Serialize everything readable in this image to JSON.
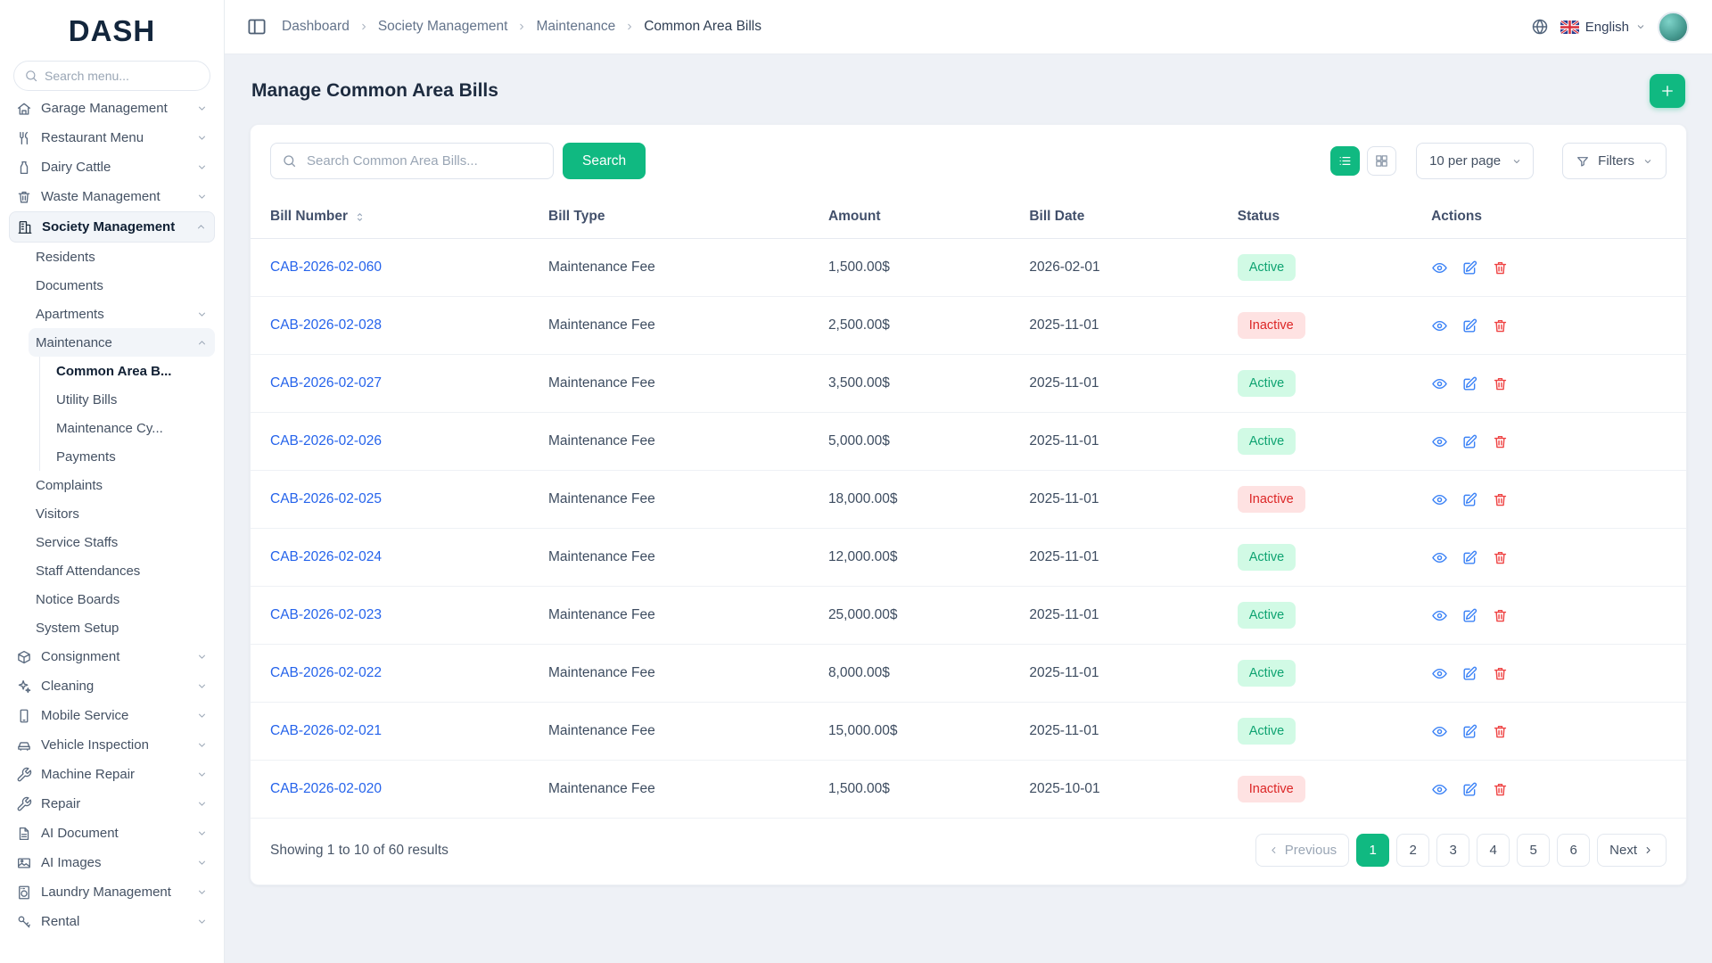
{
  "app": {
    "logo": "DASH"
  },
  "sidebar": {
    "search_placeholder": "Search menu...",
    "menu": [
      {
        "label": "Garage Management",
        "icon": "garage-icon",
        "chevron": "down"
      },
      {
        "label": "Restaurant Menu",
        "icon": "restaurant-icon",
        "chevron": "down"
      },
      {
        "label": "Dairy Cattle",
        "icon": "dairy-icon",
        "chevron": "down"
      },
      {
        "label": "Waste Management",
        "icon": "waste-icon",
        "chevron": "down"
      },
      {
        "label": "Society Management",
        "icon": "society-icon",
        "chevron": "up",
        "active": true,
        "children": [
          {
            "label": "Residents"
          },
          {
            "label": "Documents"
          },
          {
            "label": "Apartments",
            "chevron": "down"
          },
          {
            "label": "Maintenance",
            "chevron": "up",
            "open": true,
            "children": [
              {
                "label": "Common Area B...",
                "active": true
              },
              {
                "label": "Utility Bills"
              },
              {
                "label": "Maintenance Cy..."
              },
              {
                "label": "Payments"
              }
            ]
          },
          {
            "label": "Complaints"
          },
          {
            "label": "Visitors"
          },
          {
            "label": "Service Staffs"
          },
          {
            "label": "Staff Attendances"
          },
          {
            "label": "Notice Boards"
          },
          {
            "label": "System Setup"
          }
        ]
      },
      {
        "label": "Consignment",
        "icon": "consignment-icon",
        "chevron": "down"
      },
      {
        "label": "Cleaning",
        "icon": "cleaning-icon",
        "chevron": "down"
      },
      {
        "label": "Mobile Service",
        "icon": "mobile-icon",
        "chevron": "down"
      },
      {
        "label": "Vehicle Inspection",
        "icon": "vehicle-icon",
        "chevron": "down"
      },
      {
        "label": "Machine Repair",
        "icon": "machine-repair-icon",
        "chevron": "down"
      },
      {
        "label": "Repair",
        "icon": "repair-icon",
        "chevron": "down"
      },
      {
        "label": "AI Document",
        "icon": "ai-document-icon",
        "chevron": "down"
      },
      {
        "label": "AI Images",
        "icon": "ai-images-icon",
        "chevron": "down"
      },
      {
        "label": "Laundry Management",
        "icon": "laundry-icon",
        "chevron": "down"
      },
      {
        "label": "Rental",
        "icon": "rental-icon",
        "chevron": "down"
      }
    ]
  },
  "topbar": {
    "breadcrumb": [
      "Dashboard",
      "Society Management",
      "Maintenance",
      "Common Area Bills"
    ],
    "language": "English"
  },
  "page": {
    "title": "Manage Common Area Bills"
  },
  "toolbar": {
    "search_placeholder": "Search Common Area Bills...",
    "search_button": "Search",
    "per_page": "10 per page",
    "filters_label": "Filters"
  },
  "table": {
    "columns": [
      "Bill Number",
      "Bill Type",
      "Amount",
      "Bill Date",
      "Status",
      "Actions"
    ],
    "rows": [
      {
        "bill_number": "CAB-2026-02-060",
        "bill_type": "Maintenance Fee",
        "amount": "1,500.00$",
        "bill_date": "2026-02-01",
        "status": "Active"
      },
      {
        "bill_number": "CAB-2026-02-028",
        "bill_type": "Maintenance Fee",
        "amount": "2,500.00$",
        "bill_date": "2025-11-01",
        "status": "Inactive"
      },
      {
        "bill_number": "CAB-2026-02-027",
        "bill_type": "Maintenance Fee",
        "amount": "3,500.00$",
        "bill_date": "2025-11-01",
        "status": "Active"
      },
      {
        "bill_number": "CAB-2026-02-026",
        "bill_type": "Maintenance Fee",
        "amount": "5,000.00$",
        "bill_date": "2025-11-01",
        "status": "Active"
      },
      {
        "bill_number": "CAB-2026-02-025",
        "bill_type": "Maintenance Fee",
        "amount": "18,000.00$",
        "bill_date": "2025-11-01",
        "status": "Inactive"
      },
      {
        "bill_number": "CAB-2026-02-024",
        "bill_type": "Maintenance Fee",
        "amount": "12,000.00$",
        "bill_date": "2025-11-01",
        "status": "Active"
      },
      {
        "bill_number": "CAB-2026-02-023",
        "bill_type": "Maintenance Fee",
        "amount": "25,000.00$",
        "bill_date": "2025-11-01",
        "status": "Active"
      },
      {
        "bill_number": "CAB-2026-02-022",
        "bill_type": "Maintenance Fee",
        "amount": "8,000.00$",
        "bill_date": "2025-11-01",
        "status": "Active"
      },
      {
        "bill_number": "CAB-2026-02-021",
        "bill_type": "Maintenance Fee",
        "amount": "15,000.00$",
        "bill_date": "2025-11-01",
        "status": "Active"
      },
      {
        "bill_number": "CAB-2026-02-020",
        "bill_type": "Maintenance Fee",
        "amount": "1,500.00$",
        "bill_date": "2025-10-01",
        "status": "Inactive"
      }
    ]
  },
  "footer": {
    "results_text": "Showing 1 to 10 of 60 results",
    "previous": "Previous",
    "next": "Next",
    "pages": [
      "1",
      "2",
      "3",
      "4",
      "5",
      "6"
    ],
    "active_page": "1"
  },
  "icons": {
    "sidebar_toggle": "panel-icon",
    "language_globe": "globe-icon",
    "language_flag": "uk-flag-icon",
    "add": "plus-icon",
    "search": "search-icon",
    "list_view": "list-icon",
    "grid_view": "grid-icon",
    "filters": "funnel-icon",
    "sort": "sort-icon",
    "view": "eye-icon",
    "edit": "edit-icon",
    "delete": "trash-icon"
  },
  "colors": {
    "accent_green": "#10b981",
    "link_blue": "#2563eb",
    "status_active_bg": "#d1fae5",
    "status_active_text": "#0ea371",
    "status_inactive_bg": "#fee2e2",
    "status_inactive_text": "#dc2626",
    "action_view": "#3b82f6",
    "action_edit": "#3b82f6",
    "action_delete": "#ef4444"
  }
}
